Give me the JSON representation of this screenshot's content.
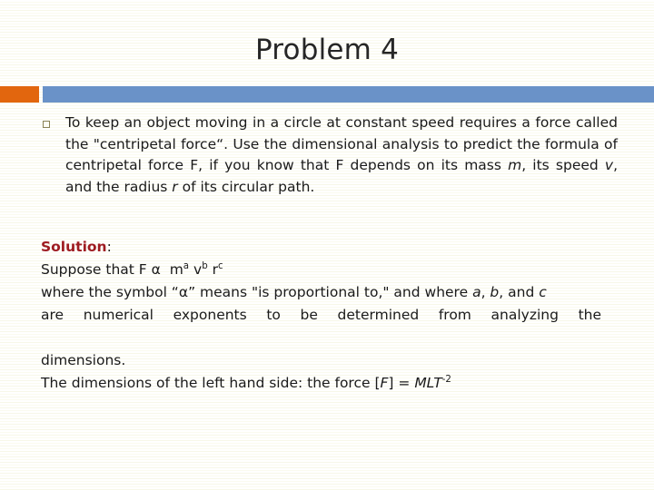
{
  "slide": {
    "title": "Problem 4",
    "accent_orange": "#E2660E",
    "accent_blue": "#6A92C8",
    "background": "#fffefa",
    "heading_color": "#262626"
  },
  "bullet": {
    "marker": "hollow-square-bullet",
    "line1": "To keep an object moving in a circle at constant speed requires a force",
    "line2": "called the \"centripetal force“. Use the dimensional analysis to predict the",
    "line3_a": "formula of centripetal force F, if you know that F depends on its mass ",
    "line3_m": "m",
    "line3_b": ",",
    "line4_a": "its speed ",
    "line4_v": "v",
    "line4_b": ", and the radius ",
    "line4_r": "r",
    "line4_c": " of its circular path."
  },
  "solution": {
    "heading": "Solution",
    "heading_color": "#9E1C22",
    "colon": ":",
    "line_suppose_prefix": "Suppose that F ",
    "line_suppose_alpha": "α",
    "line_suppose_m": "m",
    "line_suppose_m_exp": "a",
    "line_suppose_v": "v",
    "line_suppose_v_exp": "b",
    "line_suppose_r": "r",
    "line_suppose_r_exp": "c",
    "line_where_a": "where the symbol “",
    "line_where_alpha": "α",
    "line_where_b": "” means \"is proportional to,\" and where ",
    "line_where_a_it": "a",
    "line_where_c": ", ",
    "line_where_b_it": "b",
    "line_where_d": ", and ",
    "line_where_c_it": "c",
    "line_are": "are numerical exponents to be determined from analyzing the",
    "line_dimensions": "dimensions.",
    "line_dim_a": "The dimensions of the left hand side: the force [",
    "line_dim_F": "F",
    "line_dim_b": "] = ",
    "line_dim_MLT": "MLT",
    "line_dim_exp": "-2"
  }
}
